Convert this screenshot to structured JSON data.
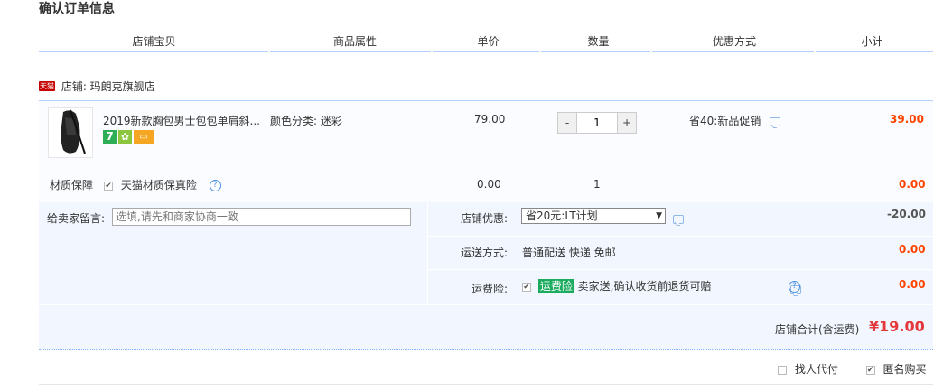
{
  "page_title": "确认订单信息",
  "columns": [
    "店铺宝贝",
    "商品属性",
    "单价",
    "数量",
    "优惠方式",
    "小计"
  ],
  "shop": {
    "badge": "天猫",
    "label": "店铺: 玛朗克旗舰店"
  },
  "item": {
    "title": "2019新款胸包男士包包单肩斜...",
    "attr": "颜色分类: 迷彩",
    "price": "79.00",
    "quantity": "1",
    "qty_minus": "-",
    "qty_plus": "+",
    "discount": "省40:新品促销",
    "subtotal": "39.00",
    "badges": [
      "7",
      "✿",
      "▭"
    ]
  },
  "guarantee": {
    "label": "材质保障",
    "option": "天猫材质保真险",
    "price": "0.00",
    "qty": "1",
    "subtotal": "0.00"
  },
  "message": {
    "label": "给卖家留言:",
    "placeholder": "选填,请先和商家协商一致"
  },
  "shop_discount": {
    "label": "店铺优惠:",
    "selected": "省20元:LT计划",
    "amount": "-20.00"
  },
  "shipping": {
    "label": "运送方式:",
    "value": "普通配送 快递 免邮",
    "amount": "0.00"
  },
  "insurance": {
    "label": "运费险:",
    "badge": "运费险",
    "desc": "卖家送,确认收货前退货可赔",
    "amount": "0.00"
  },
  "total": {
    "label": "店铺合计(含运费)",
    "value": "¥19.00"
  },
  "footer": {
    "proxy": "找人代付",
    "anonymous": "匿名购买"
  },
  "colors": {
    "accent_red": "#ff4400",
    "header_line": "#b2d1ff",
    "panel_bg": "#f2f7ff"
  }
}
